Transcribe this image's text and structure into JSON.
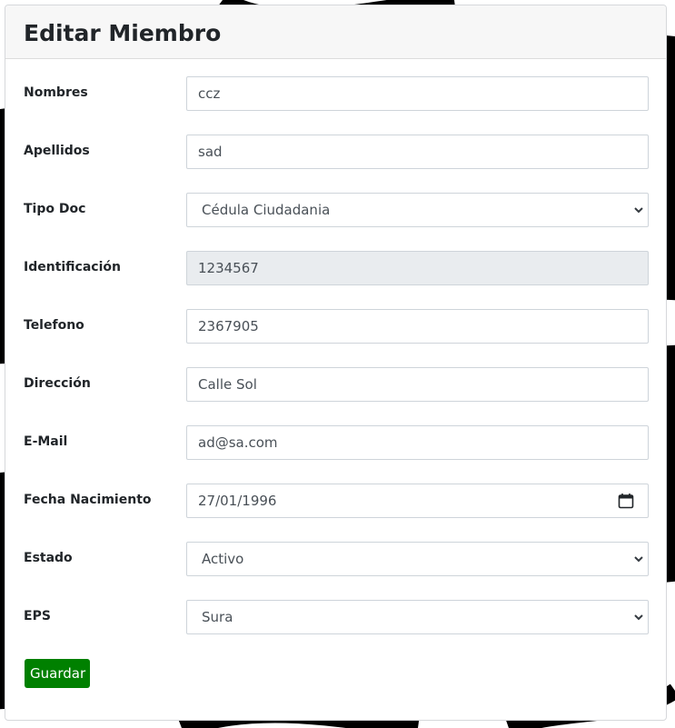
{
  "form": {
    "title": "Editar Miembro",
    "fields": [
      {
        "label": "Nombres",
        "value": "ccz"
      },
      {
        "label": "Apellidos",
        "value": "sad"
      },
      {
        "label": "Tipo Doc",
        "value": "Cédula Ciudadania"
      },
      {
        "label": "Identificación",
        "value": "1234567"
      },
      {
        "label": "Telefono",
        "value": "2367905"
      },
      {
        "label": "Dirección",
        "value": "Calle Sol"
      },
      {
        "label": "E-Mail",
        "value": "ad@sa.com"
      },
      {
        "label": "Fecha Nacimiento",
        "value": "27/01/1996"
      },
      {
        "label": "Estado",
        "value": "Activo"
      },
      {
        "label": "EPS",
        "value": "Sura"
      }
    ],
    "save_label": "Guardar"
  },
  "icons": {
    "select_chevron": "chevron-down-icon",
    "date_picker": "calendar-icon"
  },
  "colors": {
    "save_button": "#008000",
    "readonly_field": "#e9ecef",
    "header_bg": "#f7f7f7"
  }
}
